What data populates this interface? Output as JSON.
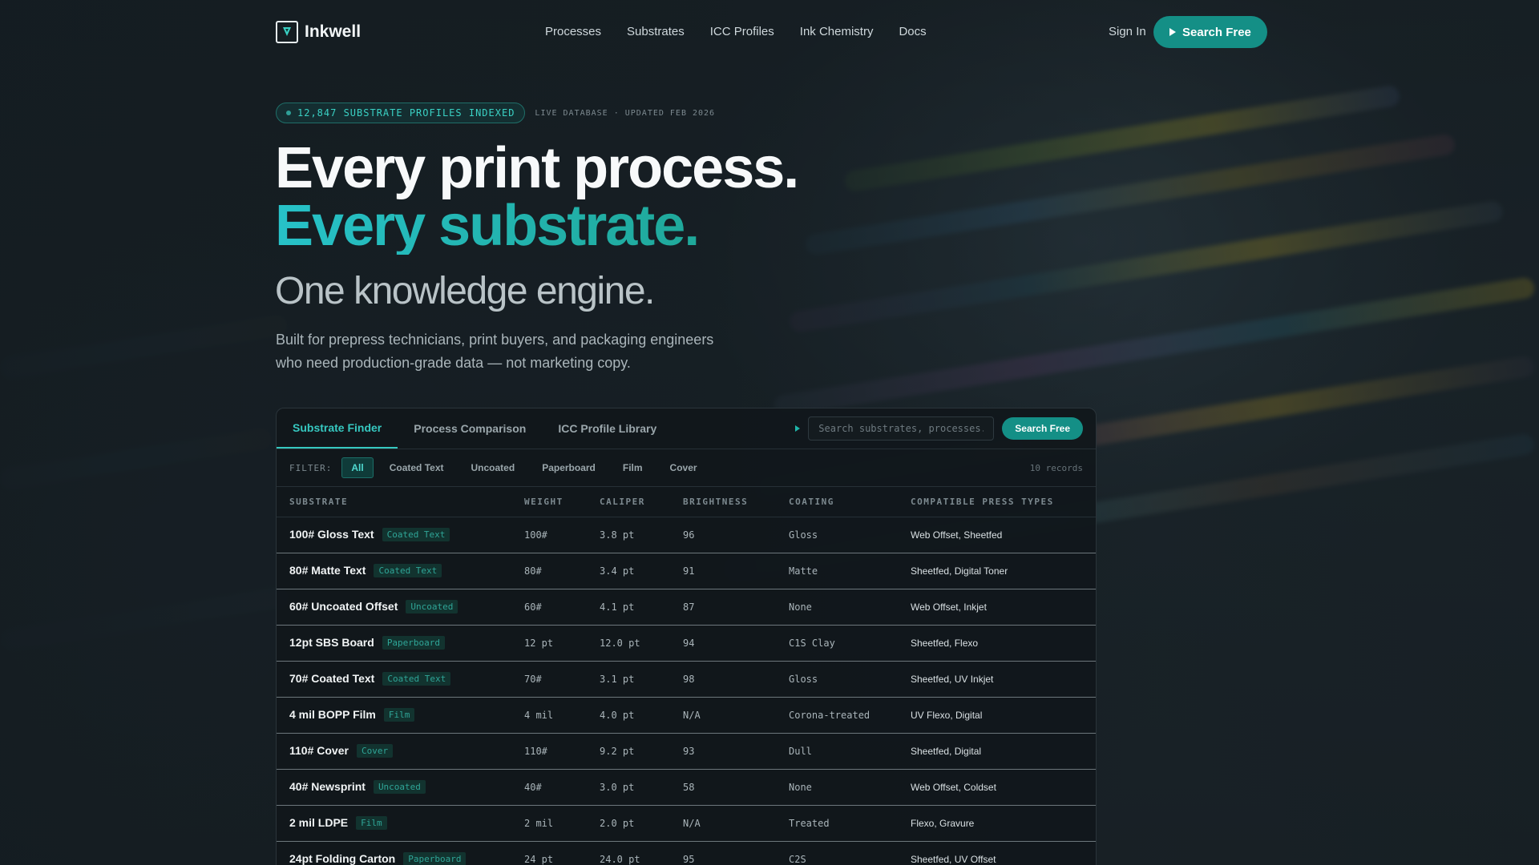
{
  "brand": {
    "name": "Inkwell"
  },
  "nav": {
    "links": [
      "Processes",
      "Substrates",
      "ICC Profiles",
      "Ink Chemistry",
      "Docs"
    ],
    "sign_in": "Sign In",
    "cta": "Search Free"
  },
  "hero": {
    "badge": "12,847 SUBSTRATE PROFILES INDEXED",
    "badge_meta": "LIVE DATABASE · UPDATED FEB 2026",
    "headline_1": "Every print process.",
    "headline_2": "Every substrate.",
    "headline_3": "One knowledge engine.",
    "lede": "Built for prepress technicians, print buyers, and packaging engineers who need production-grade data — not marketing copy."
  },
  "panel": {
    "tabs": [
      "Substrate Finder",
      "Process Comparison",
      "ICC Profile Library"
    ],
    "search_placeholder": "Search substrates, processes...",
    "search_button": "Search Free",
    "filter_label": "FILTER:",
    "filters": [
      "All",
      "Coated Text",
      "Uncoated",
      "Paperboard",
      "Film",
      "Cover"
    ],
    "records": "10 records",
    "columns": [
      "SUBSTRATE",
      "WEIGHT",
      "CALIPER",
      "BRIGHTNESS",
      "COATING",
      "COMPATIBLE PRESS TYPES"
    ],
    "rows": [
      {
        "name": "100# Gloss Text",
        "tag": "Coated Text",
        "weight": "100#",
        "caliper": "3.8 pt",
        "brightness": "96",
        "coating": "Gloss",
        "press": "Web Offset, Sheetfed"
      },
      {
        "name": "80# Matte Text",
        "tag": "Coated Text",
        "weight": "80#",
        "caliper": "3.4 pt",
        "brightness": "91",
        "coating": "Matte",
        "press": "Sheetfed, Digital Toner"
      },
      {
        "name": "60# Uncoated Offset",
        "tag": "Uncoated",
        "weight": "60#",
        "caliper": "4.1 pt",
        "brightness": "87",
        "coating": "None",
        "press": "Web Offset, Inkjet"
      },
      {
        "name": "12pt SBS Board",
        "tag": "Paperboard",
        "weight": "12 pt",
        "caliper": "12.0 pt",
        "brightness": "94",
        "coating": "C1S Clay",
        "press": "Sheetfed, Flexo"
      },
      {
        "name": "70# Coated Text",
        "tag": "Coated Text",
        "weight": "70#",
        "caliper": "3.1 pt",
        "brightness": "98",
        "coating": "Gloss",
        "press": "Sheetfed, UV Inkjet"
      },
      {
        "name": "4 mil BOPP Film",
        "tag": "Film",
        "weight": "4 mil",
        "caliper": "4.0 pt",
        "brightness": "N/A",
        "coating": "Corona-treated",
        "press": "UV Flexo, Digital"
      },
      {
        "name": "110# Cover",
        "tag": "Cover",
        "weight": "110#",
        "caliper": "9.2 pt",
        "brightness": "93",
        "coating": "Dull",
        "press": "Sheetfed, Digital"
      },
      {
        "name": "40# Newsprint",
        "tag": "Uncoated",
        "weight": "40#",
        "caliper": "3.0 pt",
        "brightness": "58",
        "coating": "None",
        "press": "Web Offset, Coldset"
      },
      {
        "name": "2 mil LDPE",
        "tag": "Film",
        "weight": "2 mil",
        "caliper": "2.0 pt",
        "brightness": "N/A",
        "coating": "Treated",
        "press": "Flexo, Gravure"
      },
      {
        "name": "24pt Folding Carton",
        "tag": "Paperboard",
        "weight": "24 pt",
        "caliper": "24.0 pt",
        "brightness": "95",
        "coating": "C2S",
        "press": "Sheetfed, UV Offset"
      }
    ]
  },
  "colors": {
    "accent": "#148f86",
    "accent_text": "#36c8c0",
    "headline_gradient": [
      "#27c2c8",
      "#1fa89a"
    ]
  }
}
